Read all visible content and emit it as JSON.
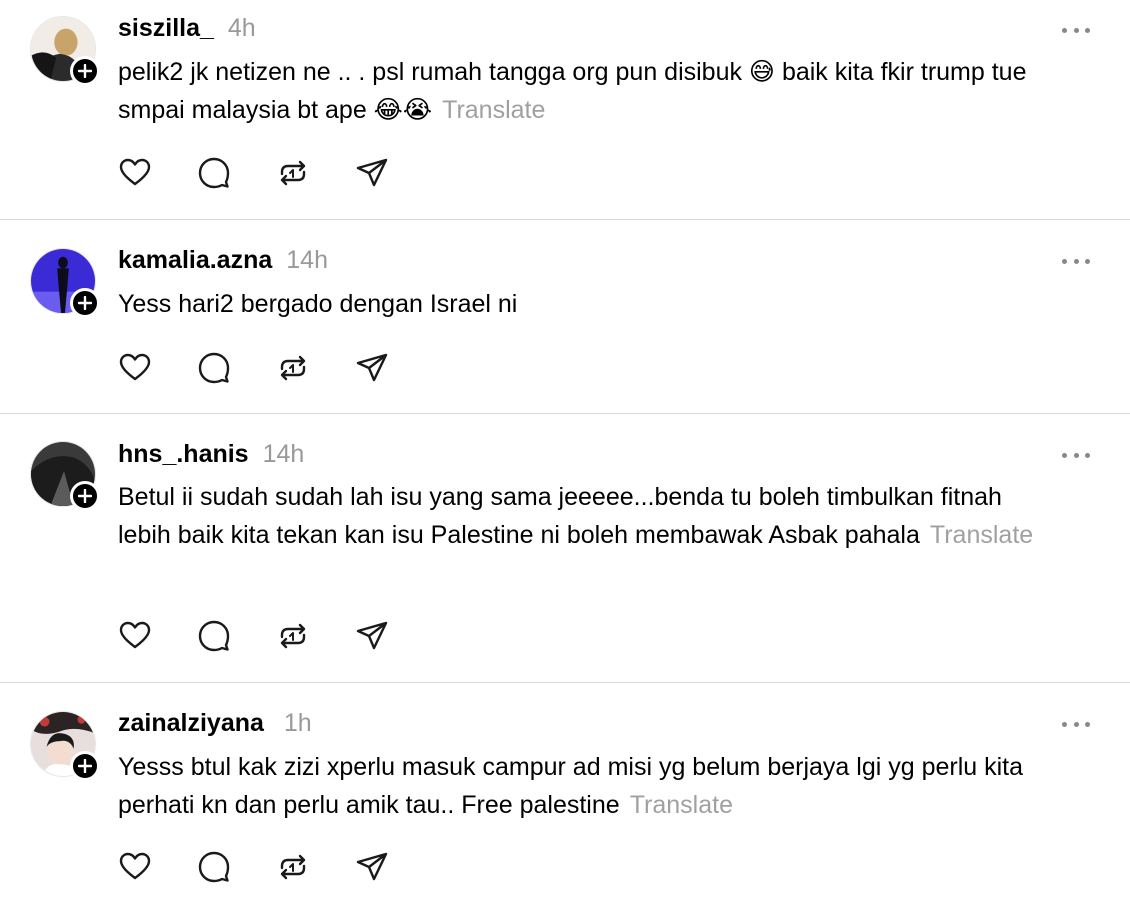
{
  "posts": [
    {
      "username": "siszilla_",
      "time": "4h",
      "text": "pelik2 jk netizen ne .. . psl rumah tangga org pun disibuk 😅 baik kita fkir trump tue smpai malaysia bt ape 😂😭",
      "translate": "Translate",
      "avatar_colors": {
        "bg": "#f1ece6",
        "fg": "#2b2b2b",
        "accent": "#c9a46a"
      }
    },
    {
      "username": "kamalia.azna",
      "time": "14h",
      "text": "Yess hari2 bergado dengan Israel ni",
      "translate": "",
      "avatar_colors": {
        "bg": "#3a2bd6",
        "fg": "#0c0c1a",
        "accent": "#7a6bff"
      }
    },
    {
      "username": "hns_.hanis",
      "time": "14h",
      "text": "Betul ii sudah sudah lah isu yang sama jeeeee...benda tu boleh timbulkan fitnah lebih baik kita tekan kan isu Palestine ni boleh membawak Asbak pahala",
      "translate": "Translate",
      "avatar_colors": {
        "bg": "#3a3a3a",
        "fg": "#1c1c1c",
        "accent": "#5b5b5b"
      }
    },
    {
      "username": "zainalziyana",
      "time": "1h",
      "text": "Yesss btul kak zizi xperlu masuk campur ad misi yg belum berjaya lgi yg perlu kita perhati kn dan perlu amik tau.. Free palestine",
      "translate": "Translate",
      "avatar_colors": {
        "bg": "#e9dede",
        "fg": "#1a1a1a",
        "accent": "#c23b3b"
      }
    }
  ],
  "icons": {
    "like": "heart-icon",
    "reply": "comment-icon",
    "repost": "repost-icon",
    "share": "send-icon",
    "more": "more-dots-icon",
    "follow": "plus-icon"
  },
  "colors": {
    "text": "#000000",
    "secondary": "#999999",
    "translate": "#a0a0a0",
    "divider": "#d9d9d9"
  }
}
